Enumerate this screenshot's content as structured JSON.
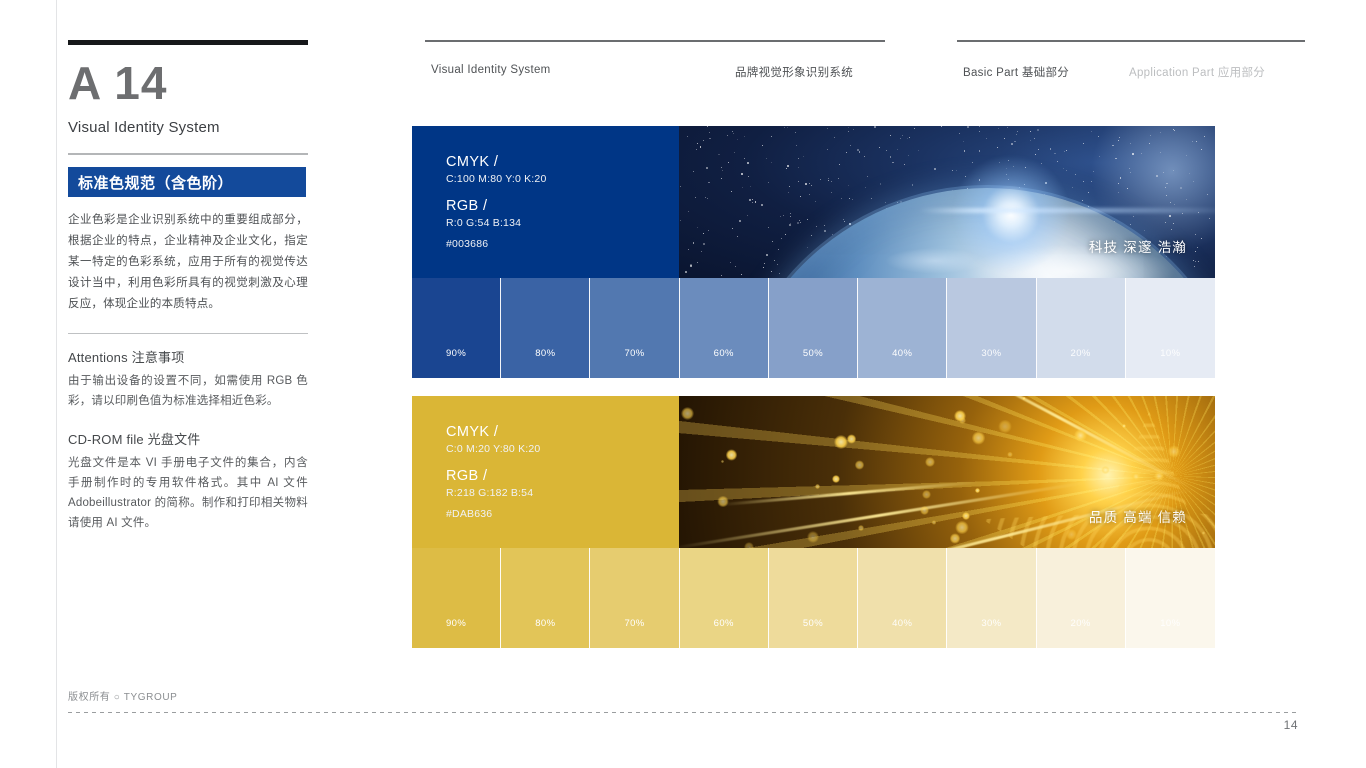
{
  "sidebar": {
    "chapter_code": "A 14",
    "chapter_subtitle": "Visual Identity System",
    "section_badge": "标准色规范（含色阶）",
    "intro_paragraph": "企业色彩是企业识别系统中的重要组成部分，根据企业的特点，企业精神及企业文化，指定某一特定的色彩系统，应用于所有的视觉传达设计当中，利用色彩所具有的视觉刺激及心理反应，体现企业的本质特点。",
    "attentions_heading": "Attentions 注意事项",
    "attentions_body": "由于输出设备的设置不同，如需使用 RGB 色彩，请以印刷色值为标准选择相近色彩。",
    "cdrom_heading": "CD-ROM file 光盘文件",
    "cdrom_body": "光盘文件是本 VI 手册电子文件的集合，内含手册制作时的专用软件格式。其中 AI 文件 Adobeillustrator 的简称。制作和打印相关物料请使用 AI 文件。"
  },
  "topnav": {
    "items": [
      {
        "label": "Visual Identity System",
        "dim": false
      },
      {
        "label": "品牌视觉形象识别系统",
        "dim": false
      },
      {
        "label": "Basic Part 基础部分",
        "dim": false
      },
      {
        "label": "Application Part 应用部分",
        "dim": true
      }
    ]
  },
  "colors": {
    "primary": {
      "cmyk_title": "CMYK /",
      "cmyk_value": "C:100 M:80 Y:0 K:20",
      "rgb_title": "RGB /",
      "rgb_value": "R:0 G:54 B:134",
      "hex_value": "#003686",
      "hex": "#003686",
      "caption": "科技 深邃 浩瀚",
      "tints": [
        {
          "label": "90%",
          "hex": "#1a4591"
        },
        {
          "label": "80%",
          "hex": "#3a63a5"
        },
        {
          "label": "70%",
          "hex": "#5278b0"
        },
        {
          "label": "60%",
          "hex": "#6b8cbd"
        },
        {
          "label": "50%",
          "hex": "#86a0c9"
        },
        {
          "label": "40%",
          "hex": "#9db3d4"
        },
        {
          "label": "30%",
          "hex": "#b9c8e0"
        },
        {
          "label": "20%",
          "hex": "#d2dceb"
        },
        {
          "label": "10%",
          "hex": "#e6ebf4"
        }
      ]
    },
    "secondary": {
      "cmyk_title": "CMYK /",
      "cmyk_value": "C:0 M:20 Y:80 K:20",
      "rgb_title": "RGB /",
      "rgb_value": "R:218 G:182 B:54",
      "hex_value": "#DAB636",
      "hex": "#DAB636",
      "caption": "品质 高端 信赖",
      "tints": [
        {
          "label": "90%",
          "hex": "#ddbc45"
        },
        {
          "label": "80%",
          "hex": "#e2c558"
        },
        {
          "label": "70%",
          "hex": "#e6cc6f"
        },
        {
          "label": "60%",
          "hex": "#ead585"
        },
        {
          "label": "50%",
          "hex": "#eedb9b"
        },
        {
          "label": "40%",
          "hex": "#f0e0ab"
        },
        {
          "label": "30%",
          "hex": "#f4e9c6"
        },
        {
          "label": "20%",
          "hex": "#f8f0db"
        },
        {
          "label": "10%",
          "hex": "#fbf7ec"
        }
      ]
    }
  },
  "footer": {
    "copyright": "版权所有 ○ TYGROUP",
    "page_number": "14"
  }
}
